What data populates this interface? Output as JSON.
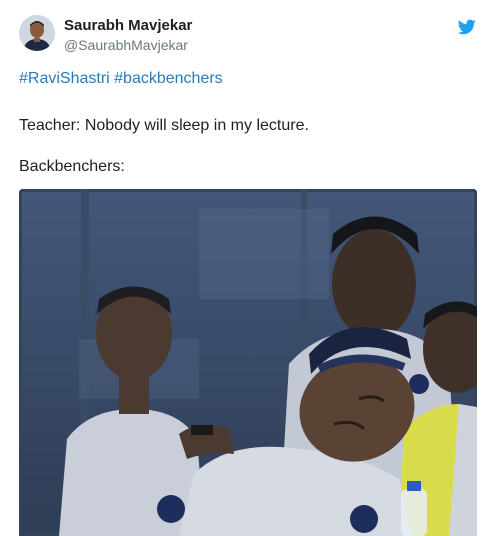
{
  "author": {
    "name": "Saurabh Mavjekar",
    "handle": "@SaurabhMavjekar"
  },
  "tweet": {
    "hashtags": [
      "#RaviShastri",
      "#backbenchers"
    ],
    "line1": "Teacher: Nobody will sleep in my lecture.",
    "line2": "Backbenchers:"
  },
  "icons": {
    "brand": "twitter-bird-icon"
  },
  "colors": {
    "link": "#2b7bb9",
    "brand": "#1da1f2",
    "secondary_text": "#697882"
  }
}
